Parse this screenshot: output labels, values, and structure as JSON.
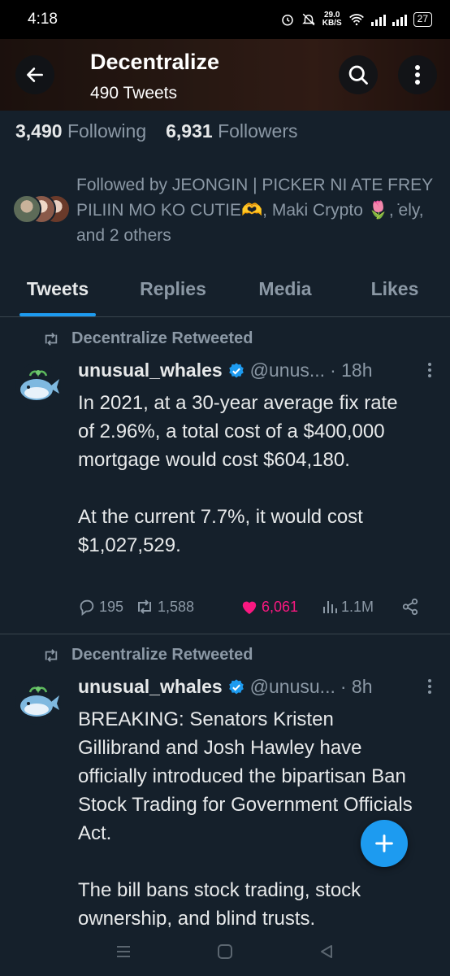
{
  "status_bar": {
    "time": "4:18",
    "net_speed_value": "29.0",
    "net_speed_unit": "KB/S",
    "battery": "27"
  },
  "header": {
    "title": "Decentralize",
    "subtitle": "490 Tweets"
  },
  "stats": {
    "following_count": "3,490",
    "following_label": "Following",
    "followers_count": "6,931",
    "followers_label": "Followers"
  },
  "followed_by": {
    "text": "Followed by JEONGIN | PICKER NI ATE FREY PILIIN MO KO CUTIE🫶, Maki Crypto 🌷, ̇ely, and 2 others"
  },
  "tabs": [
    {
      "label": "Tweets"
    },
    {
      "label": "Replies"
    },
    {
      "label": "Media"
    },
    {
      "label": "Likes"
    }
  ],
  "tweets": [
    {
      "retweet_label": "Decentralize Retweeted",
      "name": "unusual_whales",
      "handle": "@unus...",
      "time": "· 18h",
      "paragraphs": [
        "In 2021, at a 30-year average fix rate of 2.96%, a total cost of a $400,000 mortgage would cost $604,180.",
        "At the current 7.7%, it would cost $1,027,529."
      ],
      "replies": "195",
      "retweets": "1,588",
      "likes": "6,061",
      "views": "1.1M"
    },
    {
      "retweet_label": "Decentralize Retweeted",
      "name": "unusual_whales",
      "handle": "@unusu...",
      "time": "· 8h",
      "paragraphs": [
        "BREAKING: Senators Kristen Gillibrand and Josh Hawley have officially introduced the bipartisan Ban Stock Trading for Government Officials Act.",
        "The bill bans stock trading, stock ownership, and blind trusts."
      ]
    }
  ],
  "colors": {
    "background": "#15202b",
    "accent": "#1d9bf0",
    "like": "#f91880",
    "muted": "#8b98a5",
    "verified": "#1d9bf0"
  },
  "icons": [
    "back-arrow-icon",
    "search-icon",
    "more-vertical-icon",
    "retweet-icon",
    "verified-badge-icon",
    "reply-icon",
    "heart-icon",
    "views-icon",
    "share-icon",
    "compose-plus-icon"
  ]
}
